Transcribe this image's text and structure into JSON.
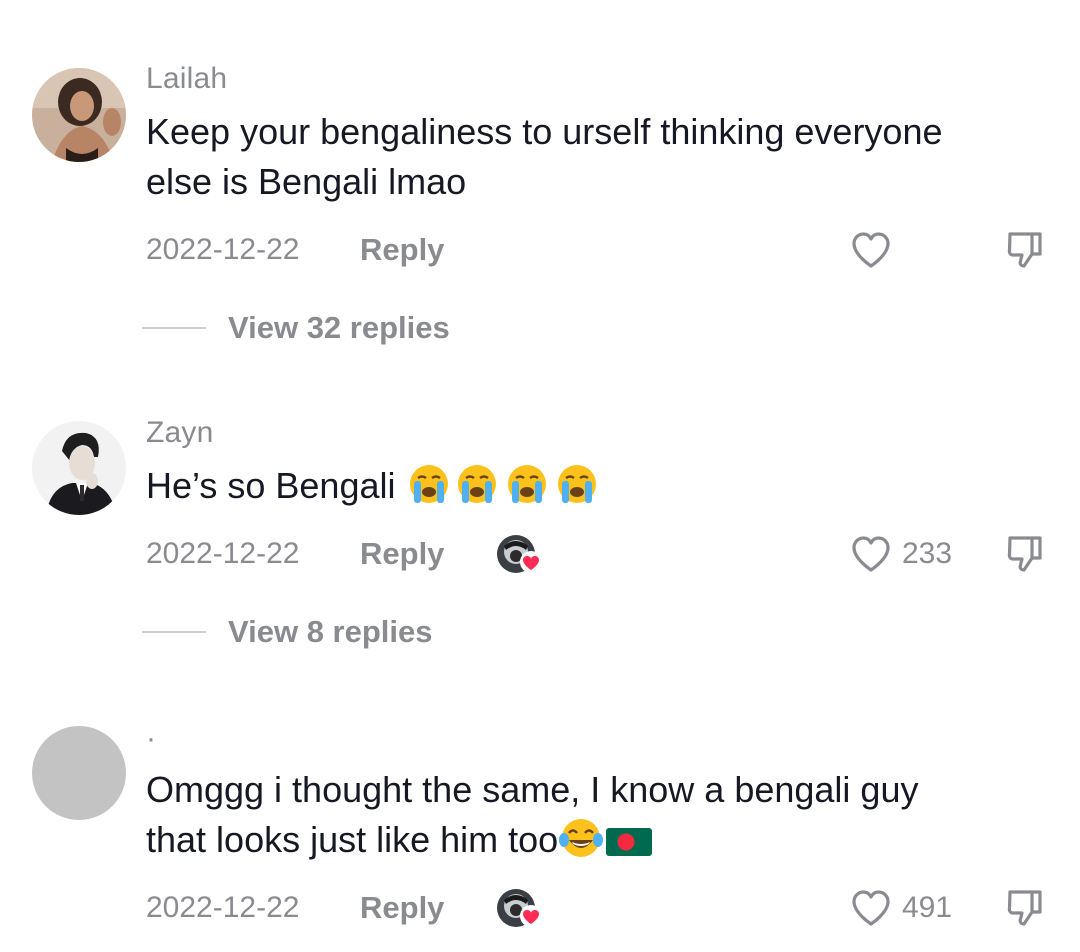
{
  "comments": [
    {
      "username": "Lailah",
      "text_lines": [
        "Keep your bengaliness to urself thinking everyone",
        "else is Bengali lmao"
      ],
      "date": "2022-12-22",
      "reply_label": "Reply",
      "like_count": "",
      "view_replies_label": "View 32 replies"
    },
    {
      "username": "Zayn",
      "text_lines": [
        "He’s so Bengali "
      ],
      "emoji": [
        "loudly-crying-face-emoji",
        "loudly-crying-face-emoji",
        "loudly-crying-face-emoji",
        "loudly-crying-face-emoji"
      ],
      "date": "2022-12-22",
      "reply_label": "Reply",
      "like_count": "233",
      "view_replies_label": "View 8 replies"
    },
    {
      "username": "·",
      "text_lines": [
        "Omggg i thought the same, I know a bengali guy",
        "that looks just like him too"
      ],
      "emoji": [
        "face-with-tears-of-joy-emoji",
        "bangladesh-flag-emoji"
      ],
      "date": "2022-12-22",
      "reply_label": "Reply",
      "like_count": "491"
    }
  ],
  "colors": {
    "text_primary": "#161823",
    "text_secondary": "#8a8b91",
    "heart_badge": "#fe2c55",
    "flag_green": "#006a4e",
    "flag_red": "#f42a41"
  }
}
